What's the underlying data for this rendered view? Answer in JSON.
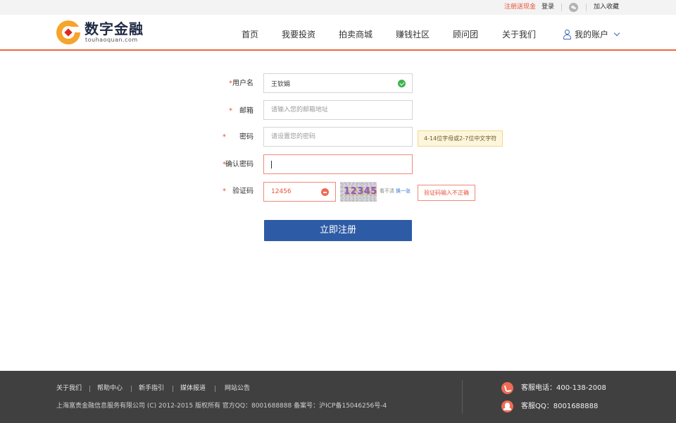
{
  "topbar": {
    "promo": "注册送现金",
    "login": "登录",
    "favorite": "加入收藏"
  },
  "brand": {
    "name": "数字金融",
    "domain": "touhaoquan.com"
  },
  "nav": {
    "items": [
      "首页",
      "我要投资",
      "拍卖商城",
      "赚钱社区",
      "顾问团",
      "关于我们"
    ],
    "account": "我的账户"
  },
  "form": {
    "username": {
      "label": "用户名",
      "value": "王钦娟",
      "status": "valid"
    },
    "email": {
      "label": "邮箱",
      "placeholder": "请输入您的邮箱地址"
    },
    "password": {
      "label": "密码",
      "placeholder": "请设置您的密码",
      "hint": "4-14位字母或2-7位中文字符"
    },
    "confirm": {
      "label": "确认密码",
      "value": ""
    },
    "captcha": {
      "label": "验证码",
      "value": "12456",
      "image_text": "12345",
      "unclear": "看不清",
      "refresh": "换一张",
      "error": "验证码输入不正确"
    },
    "required_mark": "*",
    "submit": "立即注册"
  },
  "footer": {
    "links": [
      "关于我们",
      "帮助中心",
      "新手指引",
      "媒体报道",
      "网站公告"
    ],
    "copyright": "上海富贵金融信息服务有限公司 (C) 2012-2015 版权所有   官方QQ：8001688888 备案号：沪ICP备15046256号-4",
    "phone": "客服电话：400-138-2008",
    "qq": "客服QQ：8001688888"
  },
  "colors": {
    "accent": "#ef6440",
    "primary_button": "#2e5ba6",
    "footer_bg": "#404040",
    "success": "#3cb34a",
    "error": "#e8533a"
  },
  "icons": [
    "wechat-icon",
    "logo-icon",
    "user-icon",
    "chevron-down-icon",
    "check-icon",
    "clear-icon",
    "phone-icon",
    "qq-icon"
  ]
}
